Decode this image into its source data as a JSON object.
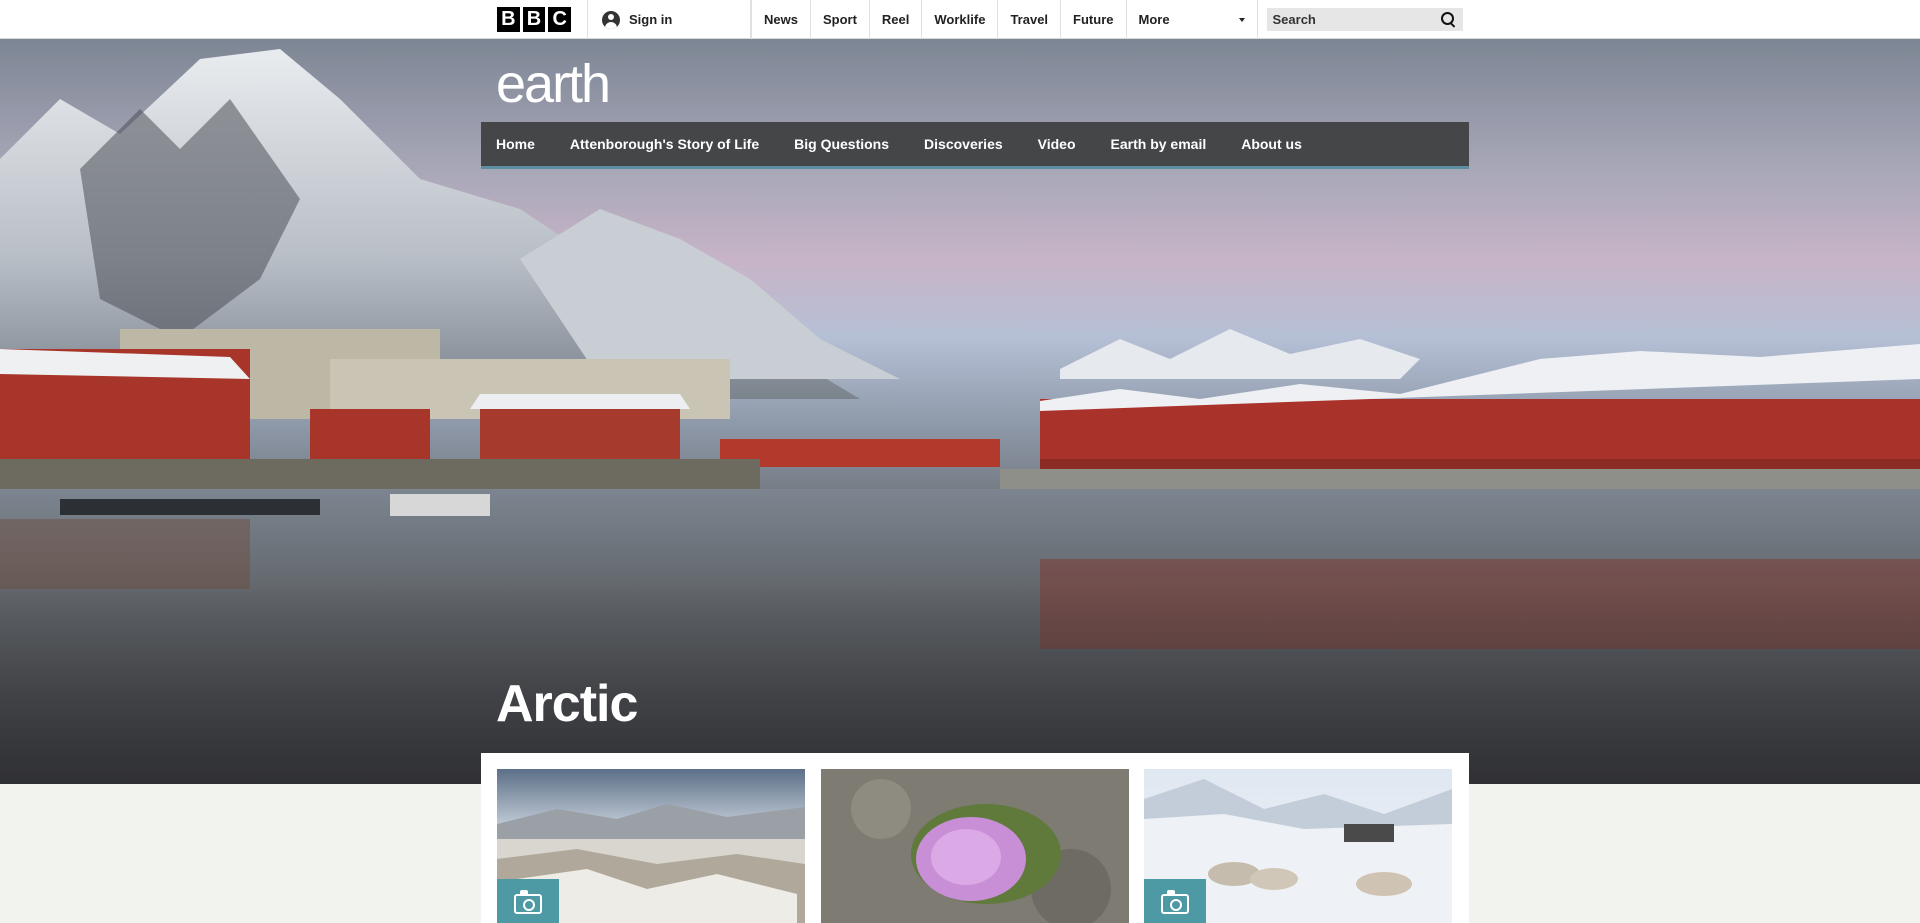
{
  "bbc": {
    "letters": [
      "B",
      "B",
      "C"
    ]
  },
  "account": {
    "signin_label": "Sign in"
  },
  "topnav": {
    "items": [
      "News",
      "Sport",
      "Reel",
      "Worklife",
      "Travel",
      "Future",
      "More"
    ]
  },
  "search": {
    "placeholder": "Search"
  },
  "brand": {
    "logo_text": "earth"
  },
  "section_nav": {
    "items": [
      "Home",
      "Attenborough's Story of Life",
      "Big Questions",
      "Discoveries",
      "Video",
      "Earth by email",
      "About us"
    ]
  },
  "hero": {
    "title": "Arctic"
  },
  "cards": [
    {
      "image": "arctic-rocky-landscape",
      "badge_icon": "camera-icon"
    },
    {
      "image": "pink-flower-cushion-on-rock",
      "badge_icon": null
    },
    {
      "image": "husky-sled-dogs-on-snow",
      "badge_icon": "camera-icon"
    }
  ],
  "colors": {
    "section_nav_bg": "#444648",
    "accent_teal": "#4e9aa4",
    "page_bg": "#f2f2ef"
  }
}
